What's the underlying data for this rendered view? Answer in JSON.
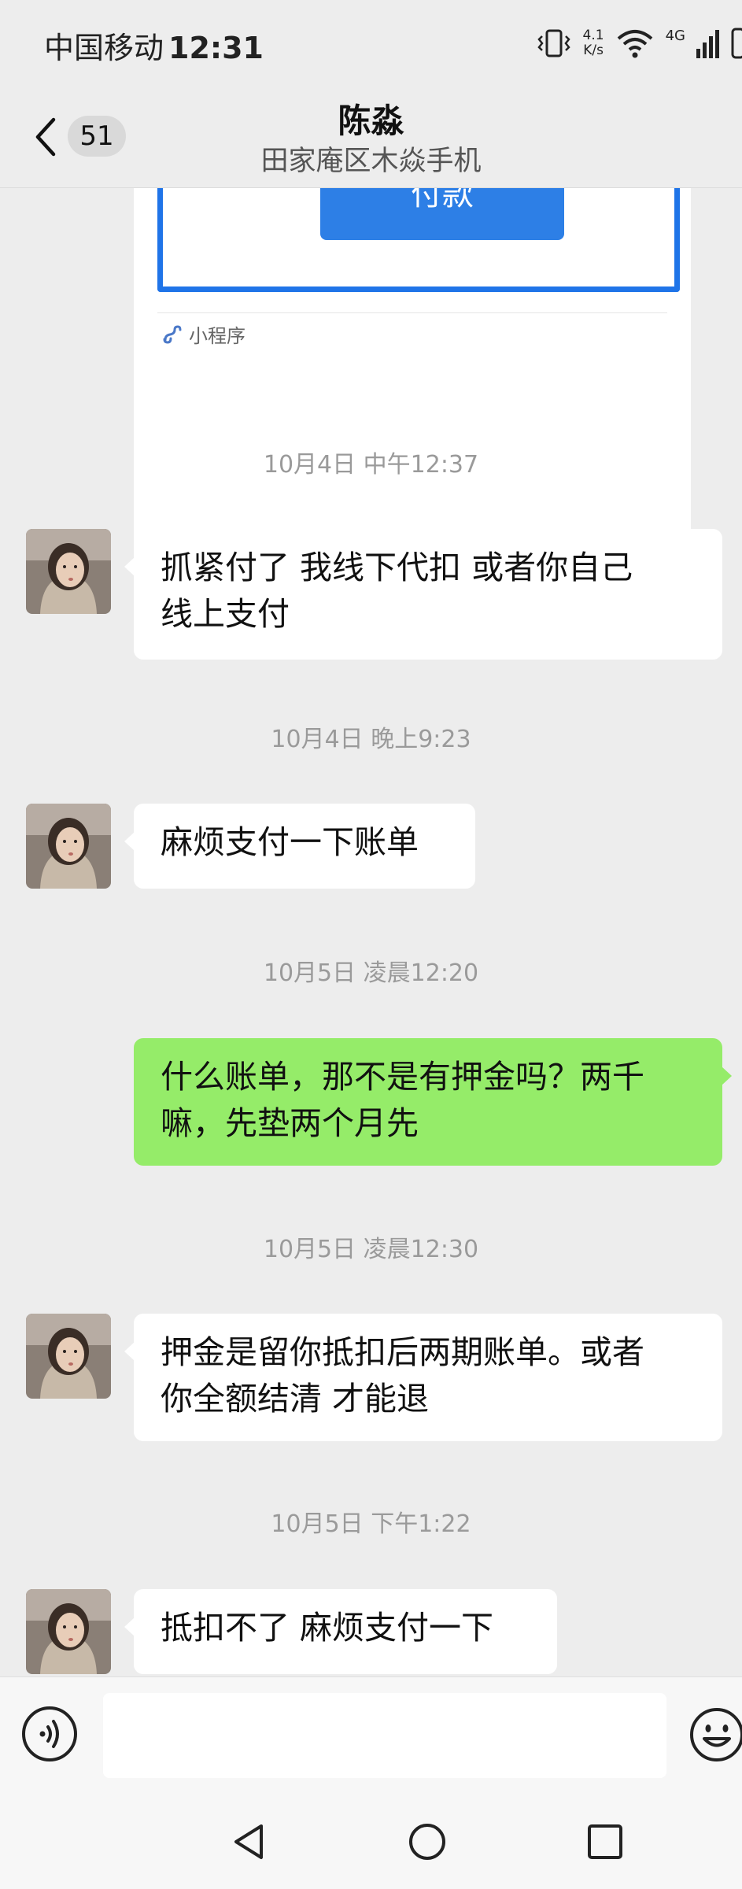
{
  "status_bar": {
    "carrier": "中国移动",
    "time": "12:31",
    "speed_value": "4.1",
    "speed_unit": "K/s",
    "network": "4G"
  },
  "header": {
    "unread_count": "51",
    "contact_name": "陈淼",
    "contact_subtitle": "田家庵区木焱手机"
  },
  "card": {
    "pay_label": "付款",
    "miniprogram_label": "小程序"
  },
  "messages": [
    {
      "type": "timestamp",
      "text": "10月4日 中午12:37"
    },
    {
      "type": "received",
      "lines": [
        "抓紧付了 我线下代扣 或者你自己",
        "线上支付"
      ]
    },
    {
      "type": "timestamp",
      "text": "10月4日 晚上9:23"
    },
    {
      "type": "received",
      "lines": [
        "麻烦支付一下账单"
      ]
    },
    {
      "type": "timestamp",
      "text": "10月5日 凌晨12:20"
    },
    {
      "type": "sent",
      "lines": [
        "什么账单，那不是有押金吗？两千",
        "嘛，先垫两个月先"
      ]
    },
    {
      "type": "timestamp",
      "text": "10月5日 凌晨12:30"
    },
    {
      "type": "received",
      "lines": [
        "押金是留你抵扣后两期账单。或者",
        "你全额结清 才能退"
      ]
    },
    {
      "type": "timestamp",
      "text": "10月5日 下午1:22"
    },
    {
      "type": "received",
      "lines": [
        "抵扣不了 麻烦支付一下"
      ]
    }
  ],
  "input": {
    "placeholder": ""
  },
  "icons": {
    "back": "back-chevron-icon",
    "voice": "voice-icon",
    "emoji": "emoji-icon",
    "mini_program": "mini-program-icon",
    "nav_back": "nav-back-icon",
    "nav_home": "nav-home-icon",
    "nav_recents": "nav-recents-icon"
  },
  "colors": {
    "background": "#ededed",
    "sent_bubble": "#95ec69",
    "received_bubble": "#ffffff",
    "pay_button": "#2d7fe6"
  }
}
